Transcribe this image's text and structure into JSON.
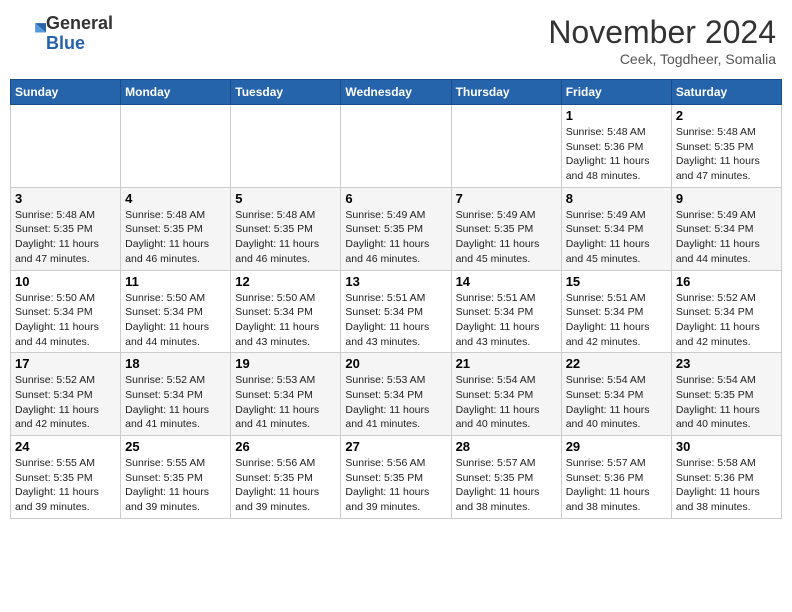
{
  "header": {
    "logo_general": "General",
    "logo_blue": "Blue",
    "month_title": "November 2024",
    "location": "Ceek, Togdheer, Somalia"
  },
  "weekdays": [
    "Sunday",
    "Monday",
    "Tuesday",
    "Wednesday",
    "Thursday",
    "Friday",
    "Saturday"
  ],
  "weeks": [
    [
      null,
      null,
      null,
      null,
      null,
      {
        "day": 1,
        "sunrise": "5:48 AM",
        "sunset": "5:36 PM",
        "daylight": "11 hours and 48 minutes."
      },
      {
        "day": 2,
        "sunrise": "5:48 AM",
        "sunset": "5:35 PM",
        "daylight": "11 hours and 47 minutes."
      }
    ],
    [
      {
        "day": 3,
        "sunrise": "5:48 AM",
        "sunset": "5:35 PM",
        "daylight": "11 hours and 47 minutes."
      },
      {
        "day": 4,
        "sunrise": "5:48 AM",
        "sunset": "5:35 PM",
        "daylight": "11 hours and 46 minutes."
      },
      {
        "day": 5,
        "sunrise": "5:48 AM",
        "sunset": "5:35 PM",
        "daylight": "11 hours and 46 minutes."
      },
      {
        "day": 6,
        "sunrise": "5:49 AM",
        "sunset": "5:35 PM",
        "daylight": "11 hours and 46 minutes."
      },
      {
        "day": 7,
        "sunrise": "5:49 AM",
        "sunset": "5:35 PM",
        "daylight": "11 hours and 45 minutes."
      },
      {
        "day": 8,
        "sunrise": "5:49 AM",
        "sunset": "5:34 PM",
        "daylight": "11 hours and 45 minutes."
      },
      {
        "day": 9,
        "sunrise": "5:49 AM",
        "sunset": "5:34 PM",
        "daylight": "11 hours and 44 minutes."
      }
    ],
    [
      {
        "day": 10,
        "sunrise": "5:50 AM",
        "sunset": "5:34 PM",
        "daylight": "11 hours and 44 minutes."
      },
      {
        "day": 11,
        "sunrise": "5:50 AM",
        "sunset": "5:34 PM",
        "daylight": "11 hours and 44 minutes."
      },
      {
        "day": 12,
        "sunrise": "5:50 AM",
        "sunset": "5:34 PM",
        "daylight": "11 hours and 43 minutes."
      },
      {
        "day": 13,
        "sunrise": "5:51 AM",
        "sunset": "5:34 PM",
        "daylight": "11 hours and 43 minutes."
      },
      {
        "day": 14,
        "sunrise": "5:51 AM",
        "sunset": "5:34 PM",
        "daylight": "11 hours and 43 minutes."
      },
      {
        "day": 15,
        "sunrise": "5:51 AM",
        "sunset": "5:34 PM",
        "daylight": "11 hours and 42 minutes."
      },
      {
        "day": 16,
        "sunrise": "5:52 AM",
        "sunset": "5:34 PM",
        "daylight": "11 hours and 42 minutes."
      }
    ],
    [
      {
        "day": 17,
        "sunrise": "5:52 AM",
        "sunset": "5:34 PM",
        "daylight": "11 hours and 42 minutes."
      },
      {
        "day": 18,
        "sunrise": "5:52 AM",
        "sunset": "5:34 PM",
        "daylight": "11 hours and 41 minutes."
      },
      {
        "day": 19,
        "sunrise": "5:53 AM",
        "sunset": "5:34 PM",
        "daylight": "11 hours and 41 minutes."
      },
      {
        "day": 20,
        "sunrise": "5:53 AM",
        "sunset": "5:34 PM",
        "daylight": "11 hours and 41 minutes."
      },
      {
        "day": 21,
        "sunrise": "5:54 AM",
        "sunset": "5:34 PM",
        "daylight": "11 hours and 40 minutes."
      },
      {
        "day": 22,
        "sunrise": "5:54 AM",
        "sunset": "5:34 PM",
        "daylight": "11 hours and 40 minutes."
      },
      {
        "day": 23,
        "sunrise": "5:54 AM",
        "sunset": "5:35 PM",
        "daylight": "11 hours and 40 minutes."
      }
    ],
    [
      {
        "day": 24,
        "sunrise": "5:55 AM",
        "sunset": "5:35 PM",
        "daylight": "11 hours and 39 minutes."
      },
      {
        "day": 25,
        "sunrise": "5:55 AM",
        "sunset": "5:35 PM",
        "daylight": "11 hours and 39 minutes."
      },
      {
        "day": 26,
        "sunrise": "5:56 AM",
        "sunset": "5:35 PM",
        "daylight": "11 hours and 39 minutes."
      },
      {
        "day": 27,
        "sunrise": "5:56 AM",
        "sunset": "5:35 PM",
        "daylight": "11 hours and 39 minutes."
      },
      {
        "day": 28,
        "sunrise": "5:57 AM",
        "sunset": "5:35 PM",
        "daylight": "11 hours and 38 minutes."
      },
      {
        "day": 29,
        "sunrise": "5:57 AM",
        "sunset": "5:36 PM",
        "daylight": "11 hours and 38 minutes."
      },
      {
        "day": 30,
        "sunrise": "5:58 AM",
        "sunset": "5:36 PM",
        "daylight": "11 hours and 38 minutes."
      }
    ]
  ]
}
